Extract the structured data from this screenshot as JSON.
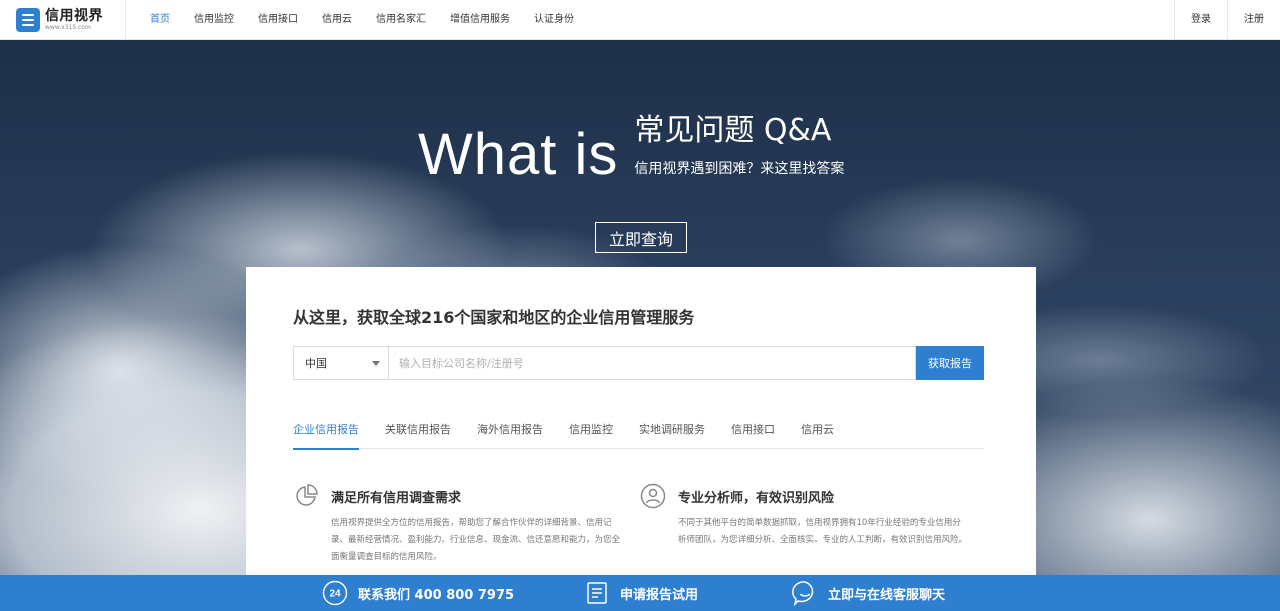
{
  "logo": {
    "name": "信用视界",
    "url": "www.x315.com"
  },
  "nav": {
    "items": [
      {
        "label": "首页",
        "active": true
      },
      {
        "label": "信用监控"
      },
      {
        "label": "信用接口"
      },
      {
        "label": "信用云"
      },
      {
        "label": "信用名家汇"
      },
      {
        "label": "增值信用服务"
      },
      {
        "label": "认证身份"
      }
    ],
    "login": "登录",
    "register": "注册"
  },
  "hero": {
    "what_is": "What is",
    "qa_title": "常见问题 Q&A",
    "qa_subtitle": "信用视界遇到困难？来这里找答案",
    "query_button": "立即查询"
  },
  "panel": {
    "title": "从这里，获取全球216个国家和地区的企业信用管理服务",
    "country": "中国",
    "search_placeholder": "输入目标公司名称/注册号",
    "search_button": "获取报告",
    "tabs": [
      {
        "label": "企业信用报告",
        "active": true
      },
      {
        "label": "关联信用报告"
      },
      {
        "label": "海外信用报告"
      },
      {
        "label": "信用监控"
      },
      {
        "label": "实地调研服务"
      },
      {
        "label": "信用接口"
      },
      {
        "label": "信用云"
      }
    ],
    "features": [
      {
        "icon": "pie-chart-icon",
        "title": "满足所有信用调查需求",
        "desc": "信用视界提供全方位的信用报告，帮助您了解合作伙伴的详细背景、信用记录、最新经营情况、盈利能力、行业信息、现金流、信还意愿和能力，为您全面衡量调查目标的信用风险。"
      },
      {
        "icon": "user-icon",
        "title": "专业分析师，有效识别风险",
        "desc": "不同于其他平台的简单数据抓取，信用视界拥有10年行业经验的专业信用分析师团队，为您详细分析、全面核实。专业的人工判断，有效识别信用风险。"
      }
    ]
  },
  "bottom_bar": {
    "contact": "联系我们 400 800 7975",
    "contact_icon_text": "24",
    "trial": "申请报告试用",
    "chat": "立即与在线客服聊天"
  },
  "colors": {
    "brand": "#2f7fd1"
  }
}
